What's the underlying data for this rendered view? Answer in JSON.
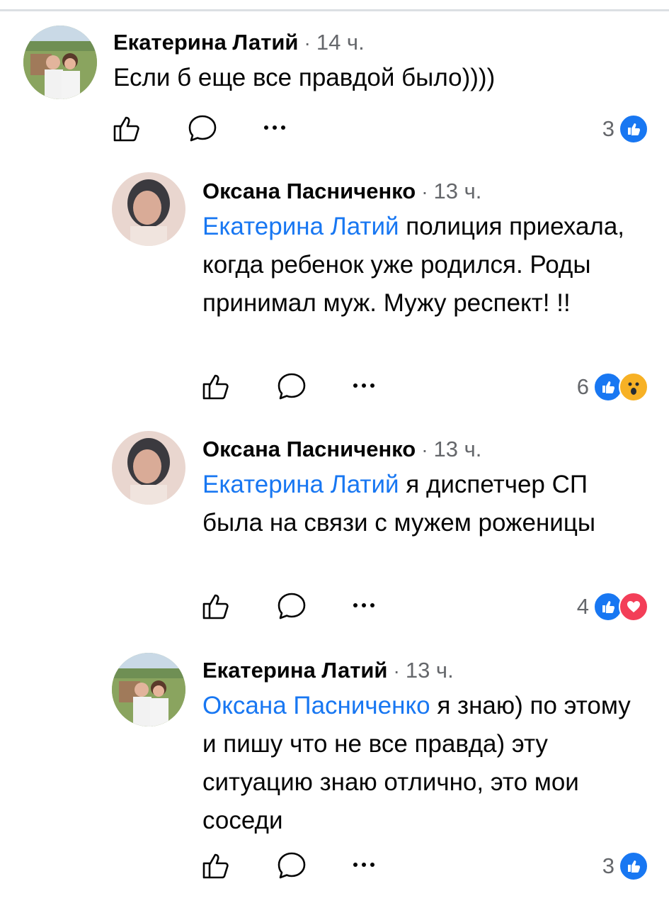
{
  "comments": [
    {
      "author": "Екатерина Латий",
      "sep": "·",
      "time": "14 ч.",
      "mention": "",
      "text": "Если б еще все правдой было))))",
      "reaction_count": "3",
      "reactions": [
        "like"
      ]
    },
    {
      "author": "Оксана Пасниченко",
      "sep": "·",
      "time": "13 ч.",
      "mention": "Екатерина Латий",
      "text": " полиция приехала, когда ребенок уже родился. Роды принимал муж. Мужу респект! !!",
      "reaction_count": "6",
      "reactions": [
        "like",
        "wow"
      ]
    },
    {
      "author": "Оксана Пасниченко",
      "sep": "·",
      "time": "13 ч.",
      "mention": "Екатерина Латий",
      "text": " я диспетчер СП была на связи с мужем роженицы",
      "reaction_count": "4",
      "reactions": [
        "like",
        "love"
      ]
    },
    {
      "author": "Екатерина Латий",
      "sep": "·",
      "time": "13 ч.",
      "mention": "Оксана Пасниченко",
      "text": " я знаю) по этому и пишу что не все правда) эту ситуацию знаю отлично, это мои соседи",
      "reaction_count": "3",
      "reactions": [
        "like"
      ]
    }
  ],
  "icons": {
    "like": "thumbs-up-icon",
    "reply": "comment-bubble-icon",
    "more": "more-dots-icon"
  },
  "colors": {
    "link": "#1877f2",
    "like": "#1877f2",
    "love": "#f33e58",
    "wow": "#f7b125",
    "meta": "#65676b"
  }
}
